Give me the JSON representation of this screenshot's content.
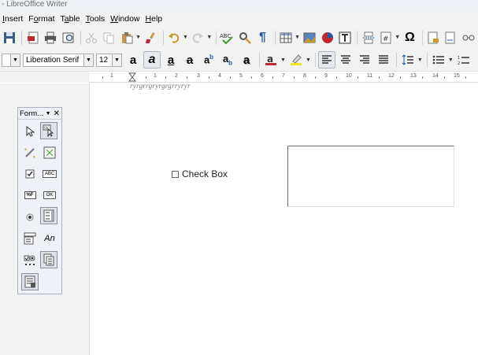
{
  "window": {
    "title": "- LibreOffice Writer"
  },
  "menu": [
    {
      "pre": "",
      "ul": "I",
      "post": "nsert"
    },
    {
      "pre": "F",
      "ul": "o",
      "post": "rmat"
    },
    {
      "pre": "T",
      "ul": "a",
      "post": "ble"
    },
    {
      "pre": "",
      "ul": "T",
      "post": "ools"
    },
    {
      "pre": "",
      "ul": "W",
      "post": "indow"
    },
    {
      "pre": "",
      "ul": "H",
      "post": "elp"
    }
  ],
  "format_bar": {
    "font_name": "Liberation Serif",
    "font_size": "12"
  },
  "ruler": {
    "labels": [
      "1",
      "1",
      "2",
      "3",
      "4",
      "5",
      "6",
      "7",
      "8",
      "9",
      "10",
      "11",
      "12",
      "13",
      "14",
      "15"
    ]
  },
  "document": {
    "cut_text": "ryrgrrgryrgrgrryryr",
    "checkbox_label": "Check Box"
  },
  "form_palette": {
    "title": "Form...",
    "text_tool_label": "An",
    "formatted_label": "%F",
    "ok_label": "OK",
    "abc_label": "ABC"
  },
  "colors": {
    "toolbar_bg": "#f2f2f2",
    "font_color": "#c0282d",
    "highlight": "#f5e51f",
    "accent": "#1e5aa8"
  }
}
